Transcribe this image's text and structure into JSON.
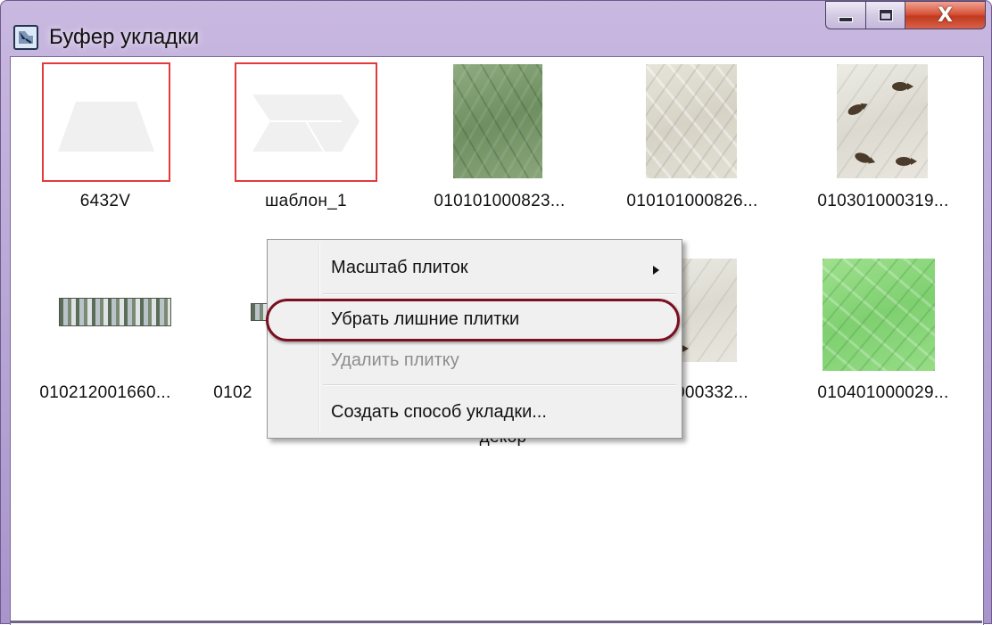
{
  "window": {
    "title": "Буфер укладки",
    "icon": "tile-layout-icon",
    "accent": "#b4a3d3",
    "buttons": {
      "minimize": "minimize-icon",
      "maximize": "maximize-icon",
      "close_glyph": "X"
    }
  },
  "tiles": [
    {
      "label": "6432V",
      "kind": "template-trapezoid",
      "selected": true
    },
    {
      "label": "шаблон_1",
      "kind": "template-chevron",
      "selected": true
    },
    {
      "label": "010101000823...",
      "kind": "marble-green"
    },
    {
      "label": "010101000826...",
      "kind": "marble-grey"
    },
    {
      "label": "010301000319...",
      "kind": "marble-fish"
    },
    {
      "label": "010212001660...",
      "kind": "border-decor"
    },
    {
      "label": "0102",
      "kind": "border-decor-small"
    },
    {
      "label": "декор",
      "kind": "hidden-by-menu"
    },
    {
      "label": "000332...",
      "kind": "marble-fish"
    },
    {
      "label": "010401000029...",
      "kind": "marble-lightgreen"
    }
  ],
  "context_menu": {
    "items": [
      {
        "label": "Масштаб плиток",
        "submenu": true,
        "enabled": true
      },
      {
        "label": "Убрать лишние плитки",
        "enabled": true,
        "highlighted": true
      },
      {
        "label": "Удалить плитку",
        "enabled": false
      },
      {
        "label": "Создать способ укладки...",
        "enabled": true
      }
    ],
    "highlight_color": "#7a1020"
  },
  "colors": {
    "selection_border": "#e23a3a",
    "disabled_text": "#8d8d8d"
  }
}
